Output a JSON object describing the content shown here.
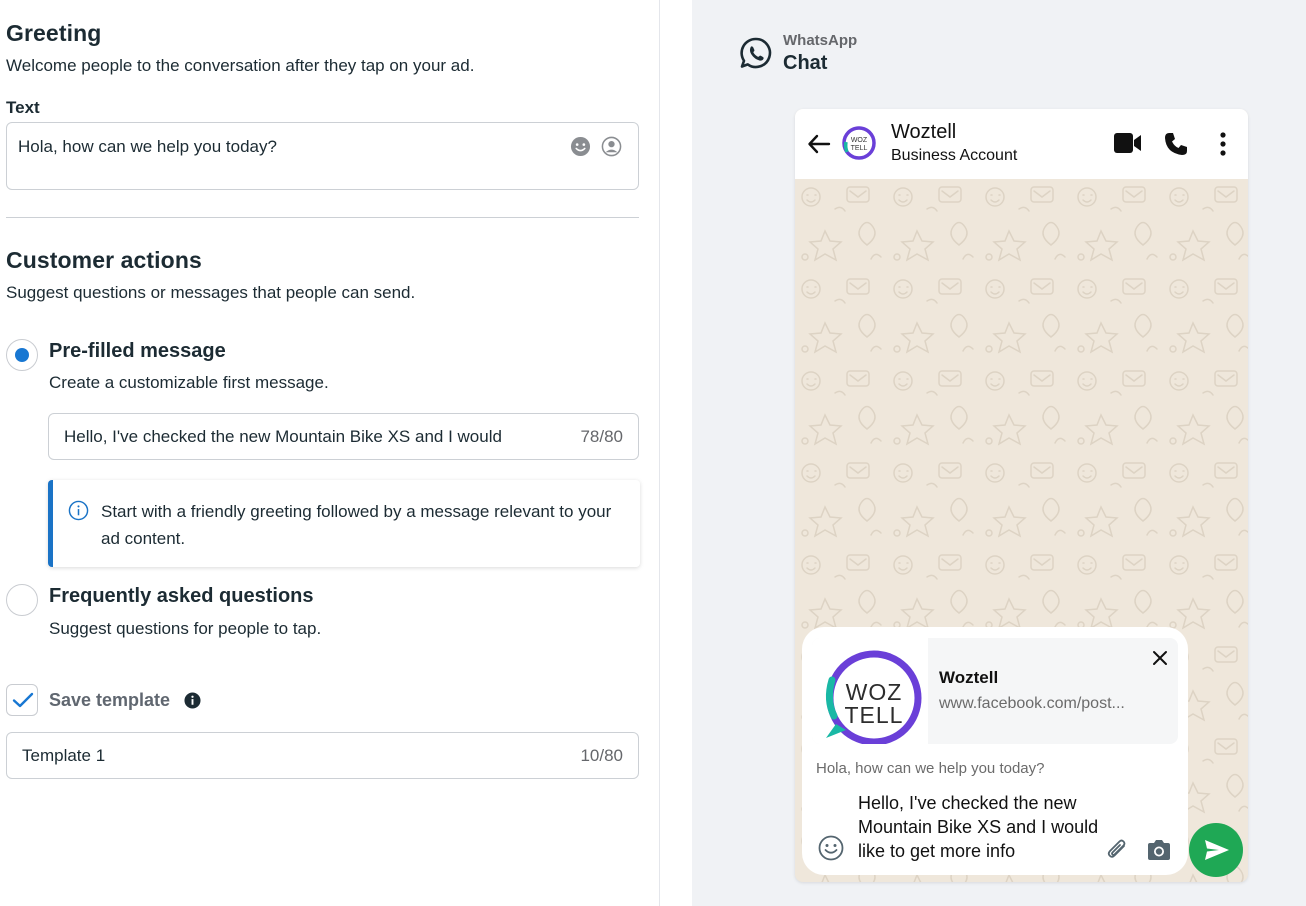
{
  "greeting": {
    "title": "Greeting",
    "description": "Welcome people to the conversation after they tap on your ad.",
    "text_label": "Text",
    "text_value": "Hola, how can we help you today?"
  },
  "customer_actions": {
    "title": "Customer actions",
    "description": "Suggest questions or messages that people can send.",
    "options": [
      {
        "title": "Pre-filled message",
        "description": "Create a customizable first message.",
        "selected": true
      },
      {
        "title": "Frequently asked questions",
        "description": "Suggest questions for people to tap.",
        "selected": false
      }
    ],
    "prefilled_value": "Hello, I've checked the new Mountain Bike XS and I would",
    "prefilled_count": "78/80",
    "hint": "Start with a friendly greeting followed by a message relevant to your ad content."
  },
  "template": {
    "checked": true,
    "label": "Save template",
    "value": "Template 1",
    "count": "10/80"
  },
  "preview": {
    "app_name": "WhatsApp",
    "panel_title": "Chat",
    "business_name": "Woztell",
    "business_subtitle": "Business Account",
    "logo_line1": "WOZ",
    "logo_line2": "TELL",
    "link_title": "Woztell",
    "link_url": "www.facebook.com/post...",
    "greeting_text": "Hola, how can we help you today?",
    "typed_message": "Hello, I've checked the new Mountain Bike XS and I would like to get more info"
  },
  "colors": {
    "accent_blue": "#1877d2",
    "hint_border": "#1a73c6",
    "send_green": "#1fa855",
    "chat_bg": "#efe7db",
    "panel_bg": "#f0f2f5"
  }
}
